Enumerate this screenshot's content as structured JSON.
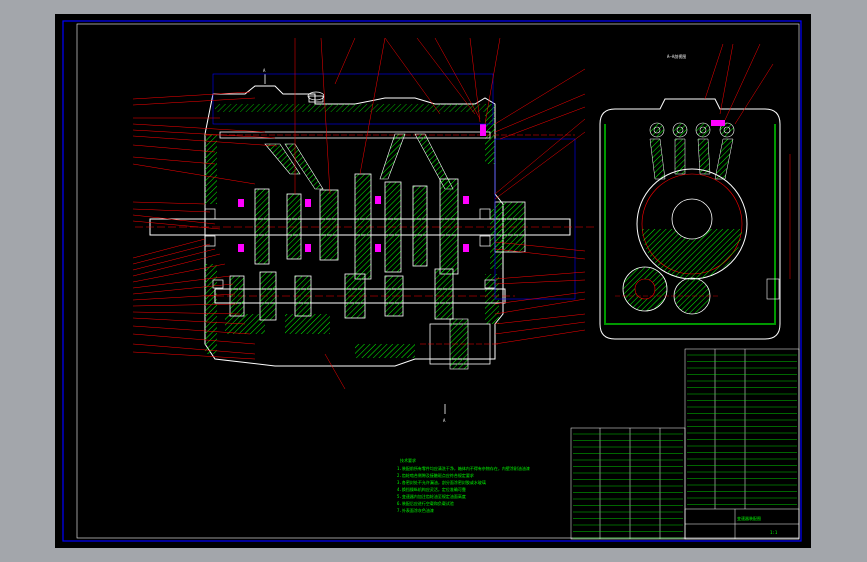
{
  "drawing": {
    "section_mark": "A",
    "section_view_label": "A—A剖视图",
    "tech_req_title": "技术要求",
    "tech_req_lines": [
      "1.装配前所有零件均应清洗干净，箱体内不得有杂物存在，内壁涂耐油油漆",
      "2.齿轮啮合侧隙及接触斑点应符合规定要求",
      "3.各密封处不允许漏油，剖分面涂密封胶或水玻璃",
      "4.换挡操纵机构应灵活，定位准确可靠",
      "5.变速器内加注齿轮油至规定油面高度",
      "6.装配后应进行空载和负载试验",
      "7.外表面涂灰色油漆"
    ],
    "title_block": {
      "title": "变速器装配图",
      "company": "",
      "sheet": "1:1"
    }
  },
  "colors": {
    "background": "#000000",
    "frame": "#0000ff",
    "outline": "#ffffff",
    "leader": "#ff0000",
    "hatch": "#00ff00",
    "centerline": "#ff0000",
    "highlight": "#ff00ff",
    "table_text": "#00ff00"
  }
}
